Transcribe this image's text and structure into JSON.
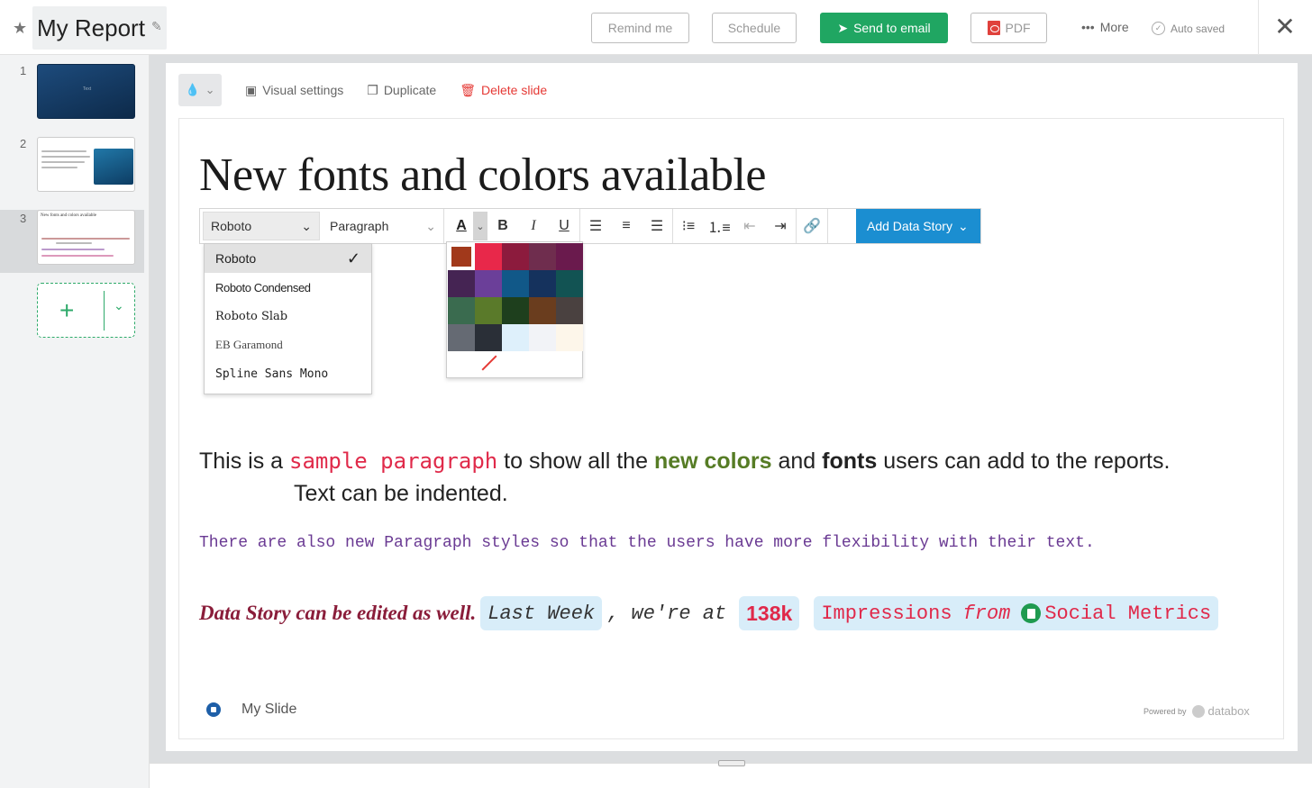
{
  "header": {
    "title": "My Report",
    "remind_label": "Remind me",
    "schedule_label": "Schedule",
    "send_label": "Send to email",
    "pdf_label": "PDF",
    "more_label": "More",
    "autosaved_label": "Auto saved"
  },
  "sidebar": {
    "slides": [
      {
        "number": "1",
        "thumb_text": "Text"
      },
      {
        "number": "2"
      },
      {
        "number": "3",
        "thumb_title": "New fonts and colors available"
      }
    ]
  },
  "slide_toolbar": {
    "visual_settings": "Visual settings",
    "duplicate": "Duplicate",
    "delete": "Delete slide"
  },
  "slide": {
    "headline": "New fonts and colors available",
    "para1": {
      "t1": "This is a ",
      "t2": "sample paragraph",
      "t3": " to show all the ",
      "t4": "new colors",
      "t5": " and ",
      "t6": "fonts",
      "t7": " users can add to the reports.",
      "t8": "Text can be indented."
    },
    "para2": "There are also new Paragraph styles so that the users have more flexibility with their text.",
    "para3": {
      "lead": "Data Story can be edited as well.",
      "period": "Last Week",
      "mid": ", we're at",
      "value": "138k",
      "metric": "Impressions",
      "from": "from",
      "source": "Social Metrics"
    },
    "footer_name": "My Slide",
    "powered_by": "Powered by",
    "brand": "databox"
  },
  "format_bar": {
    "font": "Roboto",
    "paragraph": "Paragraph",
    "add_data_story": "Add Data Story"
  },
  "font_dropdown": {
    "options": [
      "Roboto",
      "Roboto Condensed",
      "Roboto Slab",
      "EB Garamond",
      "Spline Sans Mono"
    ],
    "selected": "Roboto"
  },
  "color_palette": {
    "selected": "#a1391b",
    "swatches": [
      "#a1391b",
      "#e8284a",
      "#8c1b3d",
      "#6f2d4e",
      "#6a1a4d",
      "#452453",
      "#6b3f99",
      "#115888",
      "#15325d",
      "#125353",
      "#3a6b4f",
      "#5a7a2a",
      "#1e3f1d",
      "#6a3d1e",
      "#4a4140",
      "#656a73",
      "#2a2f37",
      "#def0fb",
      "#f2f3f7",
      "#fdf6ea"
    ]
  }
}
